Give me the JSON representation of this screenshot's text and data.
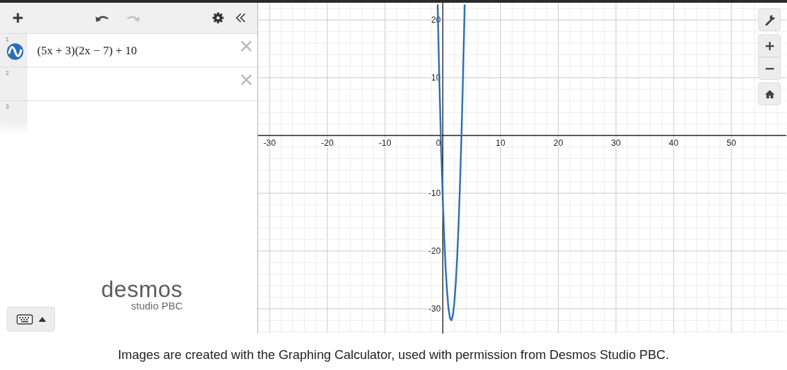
{
  "toolbar": {
    "undo": {
      "disabled": false
    },
    "redo": {
      "disabled": true
    }
  },
  "expressions": [
    {
      "number": "1",
      "kind": "expression",
      "latex": "(5x + 3)(2x − 7) + 10",
      "color": "#2d70b3"
    },
    {
      "number": "2",
      "kind": "empty"
    },
    {
      "number": "3",
      "kind": "new"
    }
  ],
  "logo": {
    "name": "desmos",
    "subtitle": "studio PBC"
  },
  "graph": {
    "chart_data": {
      "type": "line",
      "xlim": [
        -32.02,
        59.52
      ],
      "ylim": [
        -34.29,
        22.98
      ],
      "xticks": [
        -30,
        -20,
        -10,
        0,
        10,
        20,
        30,
        40,
        50
      ],
      "yticks": [
        -30,
        -20,
        -10,
        10,
        20
      ],
      "grid": true,
      "series": [
        {
          "color": "#2d70b3",
          "x": [
            -0.89,
            -0.75,
            -0.5,
            -0.25,
            0,
            0.25,
            0.5,
            0.75,
            1,
            1.25,
            1.5,
            1.75,
            2,
            2.25,
            2.5,
            2.75,
            3,
            3.25,
            3.5,
            3.75,
            3.79
          ],
          "values": [
            22.7,
            16.4,
            6,
            -3.1,
            -11,
            -17.6,
            -23,
            -27.1,
            -30,
            -31.6,
            -32,
            -31.1,
            -29,
            -25.6,
            -21,
            -15.1,
            -8,
            0.4,
            10,
            20.9,
            22.7
          ]
        }
      ]
    }
  },
  "caption": "Images are created with the Graphing Calculator, used with permission from Desmos Studio PBC."
}
